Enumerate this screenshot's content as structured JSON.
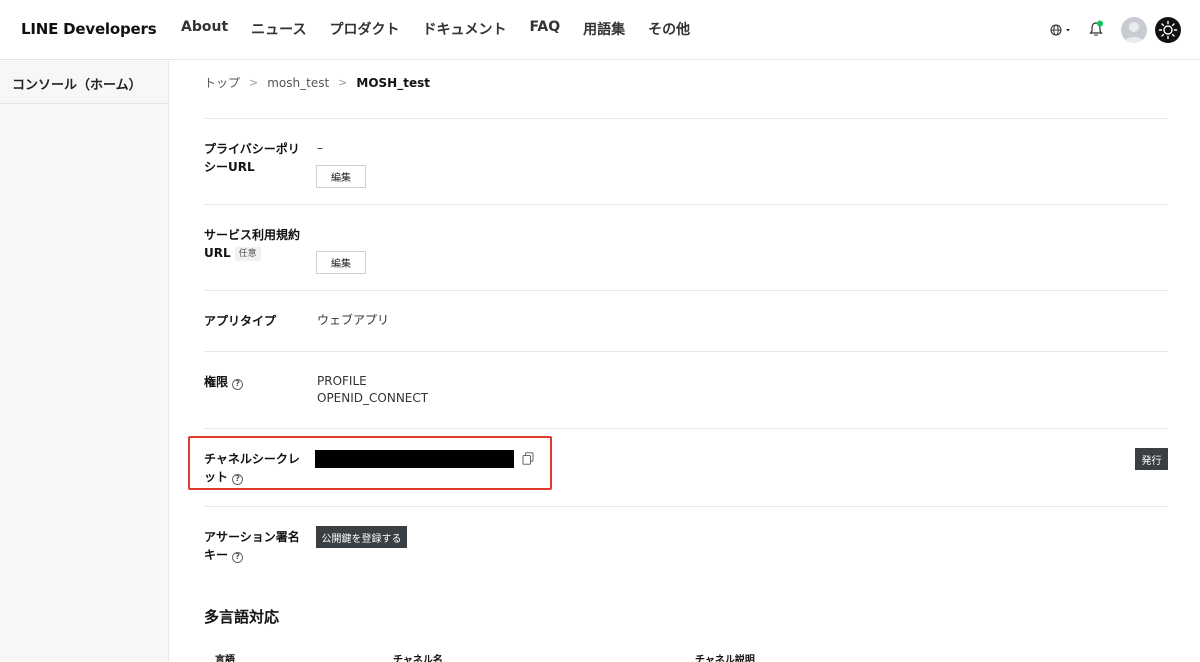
{
  "header": {
    "logo": "LINE Developers",
    "nav": [
      "About",
      "ニュース",
      "プロダクト",
      "ドキュメント",
      "FAQ",
      "用語集",
      "その他"
    ]
  },
  "sidebar": {
    "items": [
      {
        "label": "コンソール（ホーム）"
      }
    ]
  },
  "breadcrumb": {
    "items": [
      "トップ",
      "mosh_test"
    ],
    "current": "MOSH_test"
  },
  "settings": {
    "privacy_policy": {
      "label": "プライバシーポリシーURL",
      "value": "–",
      "edit_label": "編集"
    },
    "terms_of_service": {
      "label": "サービス利用規約URL",
      "optional_badge": "任意",
      "edit_label": "編集"
    },
    "app_type": {
      "label": "アプリタイプ",
      "value": "ウェブアプリ"
    },
    "permissions": {
      "label": "権限",
      "values": [
        "PROFILE",
        "OPENID_CONNECT"
      ]
    },
    "channel_secret": {
      "label": "チャネルシークレット",
      "issue_label": "発行"
    },
    "assertion_signing_key": {
      "label": "アサーション署名キー",
      "register_label": "公開鍵を登録する"
    }
  },
  "multilingual": {
    "title": "多言語対応",
    "columns": [
      "言語",
      "チャネル名",
      "チャネル説明"
    ]
  },
  "colors": {
    "highlight": "#e03a2e",
    "notification_dot": "#06c755",
    "dark_button": "#3a3f44"
  }
}
